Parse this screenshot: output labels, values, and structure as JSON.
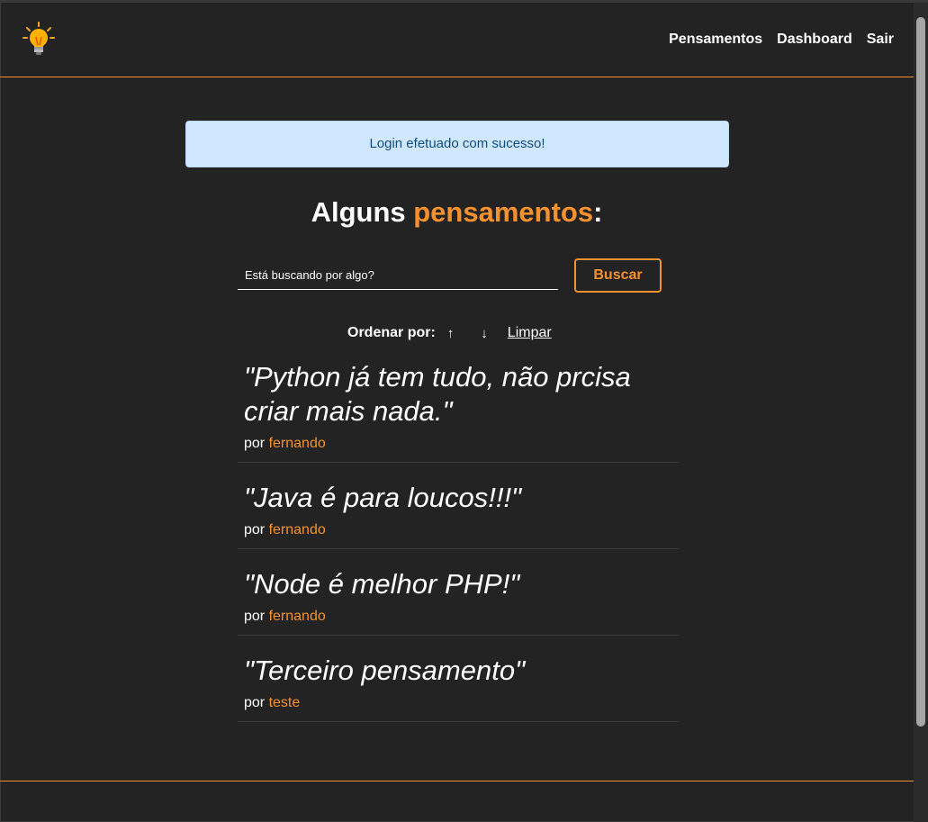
{
  "nav": {
    "links": [
      "Pensamentos",
      "Dashboard",
      "Sair"
    ]
  },
  "flash": {
    "message": "Login efetuado com sucesso!"
  },
  "title": {
    "prefix": "Alguns ",
    "accent": "pensamentos",
    "suffix": ":"
  },
  "search": {
    "placeholder": "Está buscando por algo?",
    "button_label": "Buscar"
  },
  "order": {
    "label": "Ordenar por:",
    "asc_icon": "↑",
    "desc_icon": "↓",
    "clear_label": "Limpar"
  },
  "thoughts": [
    {
      "text": "\"Python já tem tudo, não prcisa criar mais nada.\"",
      "by": "por ",
      "author": "fernando"
    },
    {
      "text": "\"Java é para loucos!!!\"",
      "by": "por ",
      "author": "fernando"
    },
    {
      "text": "\"Node é melhor PHP!\"",
      "by": "por ",
      "author": "fernando"
    },
    {
      "text": "\"Terceiro pensamento\"",
      "by": "por ",
      "author": "teste"
    }
  ],
  "colors": {
    "accent": "#f5922d",
    "background": "#232323",
    "flash_bg": "#cfe7ff",
    "flash_text": "#0f4c81"
  }
}
